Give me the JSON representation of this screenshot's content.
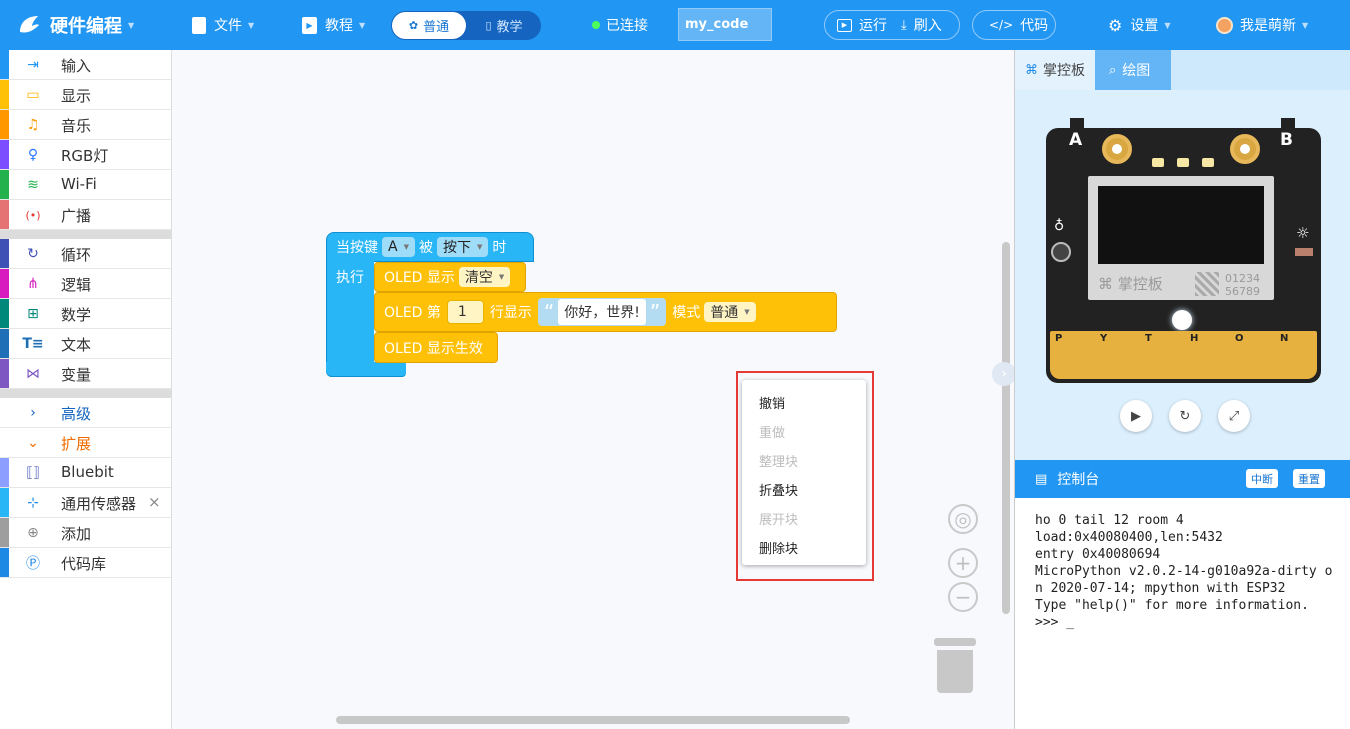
{
  "app": {
    "title": "硬件编程",
    "menu_file": "文件",
    "menu_tutorial": "教程",
    "mode_normal": "普通",
    "mode_teach": "教学",
    "connection_status": "已连接",
    "filename": "my_code",
    "run": "运行",
    "flash": "刷入",
    "code": "代码",
    "settings": "设置",
    "user": "我是萌新"
  },
  "palette": {
    "categories": [
      {
        "label": "输入",
        "color": "#2196f3",
        "icon": "input-icon"
      },
      {
        "label": "显示",
        "color": "#ffc107",
        "icon": "display-icon"
      },
      {
        "label": "音乐",
        "color": "#ff9800",
        "icon": "music-icon"
      },
      {
        "label": "RGB灯",
        "color": "#7c4dff",
        "icon": "bulb-icon"
      },
      {
        "label": "Wi-Fi",
        "color": "#22b14c",
        "icon": "wifi-icon"
      },
      {
        "label": "广播",
        "color": "#e57373",
        "icon": "broadcast-icon"
      },
      {
        "label": "循环",
        "color": "#3f51b5",
        "icon": "loop-icon"
      },
      {
        "label": "逻辑",
        "color": "#d81bbf",
        "icon": "logic-icon"
      },
      {
        "label": "数学",
        "color": "#00897b",
        "icon": "math-icon"
      },
      {
        "label": "文本",
        "color": "#1e6fb5",
        "icon": "text-icon"
      },
      {
        "label": "变量",
        "color": "#7e57c2",
        "icon": "variable-icon"
      },
      {
        "label": "高级",
        "color": "#1565c0",
        "icon": "chevron-right-icon"
      },
      {
        "label": "扩展",
        "color": "#ef6c00",
        "icon": "chevron-down-icon"
      },
      {
        "label": "Bluebit",
        "color": "#8c9eff",
        "icon": "bluebit-icon"
      },
      {
        "label": "通用传感器",
        "color": "#29b6f6",
        "icon": "sensor-icon"
      },
      {
        "label": "添加",
        "color": "#9e9e9e",
        "icon": "add-icon"
      },
      {
        "label": "代码库",
        "color": "#1e88e5",
        "icon": "code-library-icon"
      }
    ],
    "remove_symbol": "×"
  },
  "blocks": {
    "hat_prefix": "当按键",
    "hat_button": "A",
    "hat_mid": "被",
    "hat_action": "按下",
    "hat_suffix": "时",
    "exec": "执行",
    "oled_show": "OLED 显示",
    "oled_clear": "清空",
    "oled_line_prefix": "OLED 第",
    "oled_line_num": "1",
    "oled_line_show": "行显示",
    "oled_text": "你好，世界!",
    "oled_mode_label": "模式",
    "oled_mode": "普通",
    "oled_apply": "OLED 显示生效"
  },
  "context_menu": {
    "items": [
      {
        "label": "撤销",
        "enabled": true
      },
      {
        "label": "重做",
        "enabled": false
      },
      {
        "label": "整理块",
        "enabled": false
      },
      {
        "label": "折叠块",
        "enabled": true
      },
      {
        "label": "展开块",
        "enabled": false
      },
      {
        "label": "删除块",
        "enabled": true
      }
    ]
  },
  "right_panel": {
    "tab_board": "掌控板",
    "tab_draw": "绘图",
    "board_brand": "掌控板",
    "board_digits_1": "01234",
    "board_digits_2": "56789",
    "board_pin_a": "A",
    "board_pin_b": "B",
    "pin_letters": [
      "P",
      "Y",
      "T",
      "H",
      "O",
      "N"
    ],
    "console_title": "控制台",
    "btn_interrupt": "中断",
    "btn_reset": "重置",
    "console_output": "ho 0 tail 12 room 4\nload:0x40080400,len:5432\nentry 0x40080694\nMicroPython v2.0.2-14-g010a92a-dirty on 2020-07-14; mpython with ESP32\nType \"help()\" for more information.\n>>> _"
  }
}
